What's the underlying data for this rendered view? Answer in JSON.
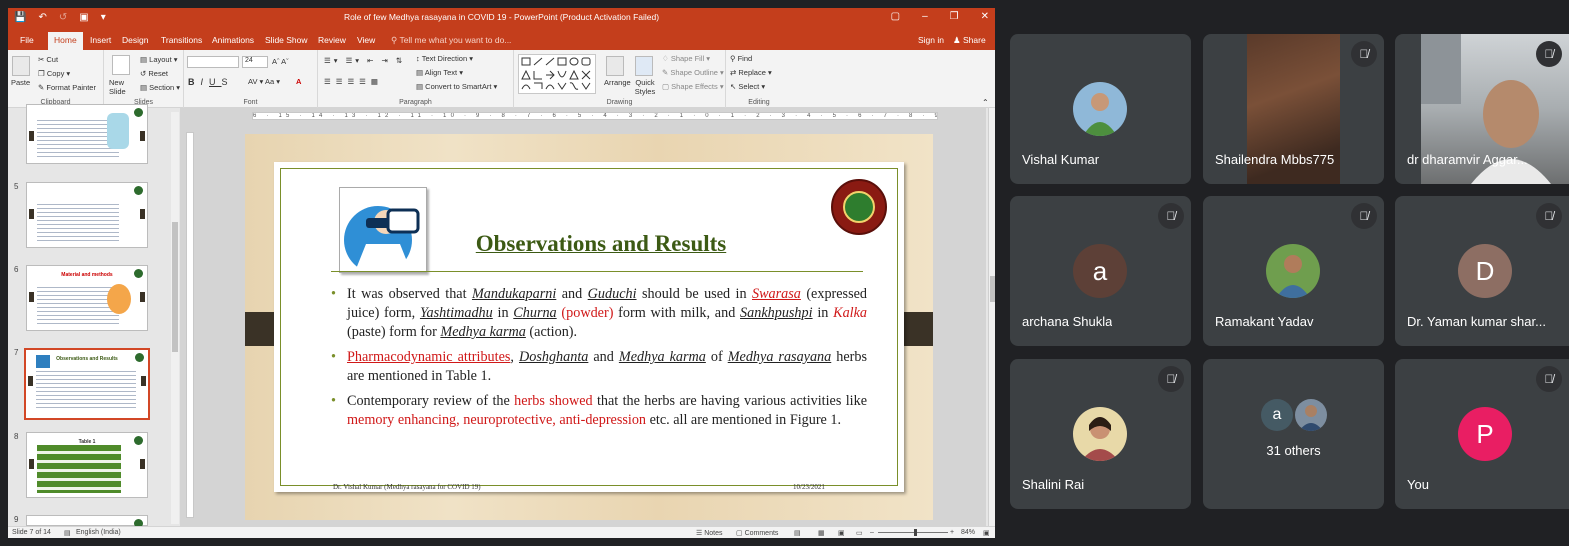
{
  "ppt": {
    "title": "Role of few Medhya rasayana in COVID 19  -  PowerPoint (Product Activation Failed)",
    "tabs": [
      "File",
      "Home",
      "Insert",
      "Design",
      "Transitions",
      "Animations",
      "Slide Show",
      "Review",
      "View"
    ],
    "tell_me": "Tell me what you want to do...",
    "sign_in": "Sign in",
    "share": "Share",
    "ribbon": {
      "paste": "Paste",
      "cut": "Cut",
      "copy": "Copy",
      "format_painter": "Format Painter",
      "clipboard": "Clipboard",
      "new_slide": "New Slide",
      "layout": "Layout",
      "reset": "Reset",
      "section": "Section",
      "slides": "Slides",
      "font_size": "24",
      "font": "Font",
      "text_direction": "Text Direction",
      "align_text": "Align Text",
      "convert_smartart": "Convert to SmartArt",
      "paragraph": "Paragraph",
      "arrange": "Arrange",
      "quick_styles": "Quick Styles",
      "shape_fill": "Shape Fill",
      "shape_outline": "Shape Outline",
      "shape_effects": "Shape Effects",
      "drawing": "Drawing",
      "find": "Find",
      "replace": "Replace",
      "select": "Select",
      "editing": "Editing"
    },
    "thumbnails": {
      "numbers": [
        "5",
        "6",
        "7",
        "8",
        "9"
      ],
      "t6_title": "Material and methods",
      "t7_title": "Observations and Results",
      "t8_title": "Table 1"
    },
    "ruler": "6 · 15 · 14 · 13 · 12 · 11 · 10 · 9 · 8 · 7 · 6 · 5 · 4 · 3 · 2 · 1 · 0 · 1 · 2 · 3 · 4 · 5 · 6 · 7 · 8 · 9 · 10 · 11 · 12 · 13 · 14 · 15 · 16",
    "slide": {
      "title": "Observations and Results",
      "b1": {
        "t1": "It was observed that ",
        "w1": "Mandukaparni",
        "t2": " and ",
        "w2": "Guduchi",
        "t3": " should be used in ",
        "w3": "Swarasa",
        "t4": " (expressed juice) form, ",
        "w4": "Yashtimadhu",
        "t5": " in ",
        "w5": "Churna",
        "t6": " ",
        "w6": "(powder)",
        "t7": " form with milk, and ",
        "w7": "Sankhpushpi",
        "t8": " in ",
        "w8": "Kalka",
        "t9": " (paste) form for ",
        "w9": "Medhya karma",
        "t10": " (action)."
      },
      "b2": {
        "w1": "Pharmacodynamic attributes",
        "t1": ", ",
        "w2": "Doshghanta",
        "t2": " and ",
        "w3": "Medhya karma",
        "t3": " of ",
        "w4": "Medhya rasayana",
        "t4": " herbs are mentioned in Table 1."
      },
      "b3": {
        "t1": "Contemporary review of the ",
        "w1": "herbs showed",
        "t2": " that the herbs are having various activities like ",
        "w2": "memory enhancing, neuroprotective, anti-depression",
        "t3": " etc. all are mentioned in Figure 1."
      },
      "footer_left": "Dr. Vishal Kumar (Medhya rasayana for COVID 19)",
      "footer_right": "10/23/2021"
    },
    "status": {
      "slide": "Slide 7 of 14",
      "language": "English (India)",
      "notes": "Notes",
      "comments": "Comments",
      "zoom": "84%"
    }
  },
  "meet": {
    "participants": [
      {
        "name": "Vishal Kumar"
      },
      {
        "name": "Shailendra Mbbs775"
      },
      {
        "name": "dr dharamvir Aggar..."
      },
      {
        "name": "archana Shukla",
        "initial": "a"
      },
      {
        "name": "Ramakant Yadav"
      },
      {
        "name": "Dr. Yaman kumar shar...",
        "initial": "D"
      },
      {
        "name": "Shalini Rai"
      },
      {
        "name": "31 others",
        "initial": "a"
      },
      {
        "name": "You",
        "initial": "P"
      }
    ]
  },
  "colors": {
    "ppt_accent": "#c43e1c",
    "meet_bg": "#202124",
    "tile_bg": "#3c4043",
    "archana": "#5d4037",
    "yaman": "#8d6e63",
    "you": "#e91e63",
    "others_a": "#455a64"
  }
}
